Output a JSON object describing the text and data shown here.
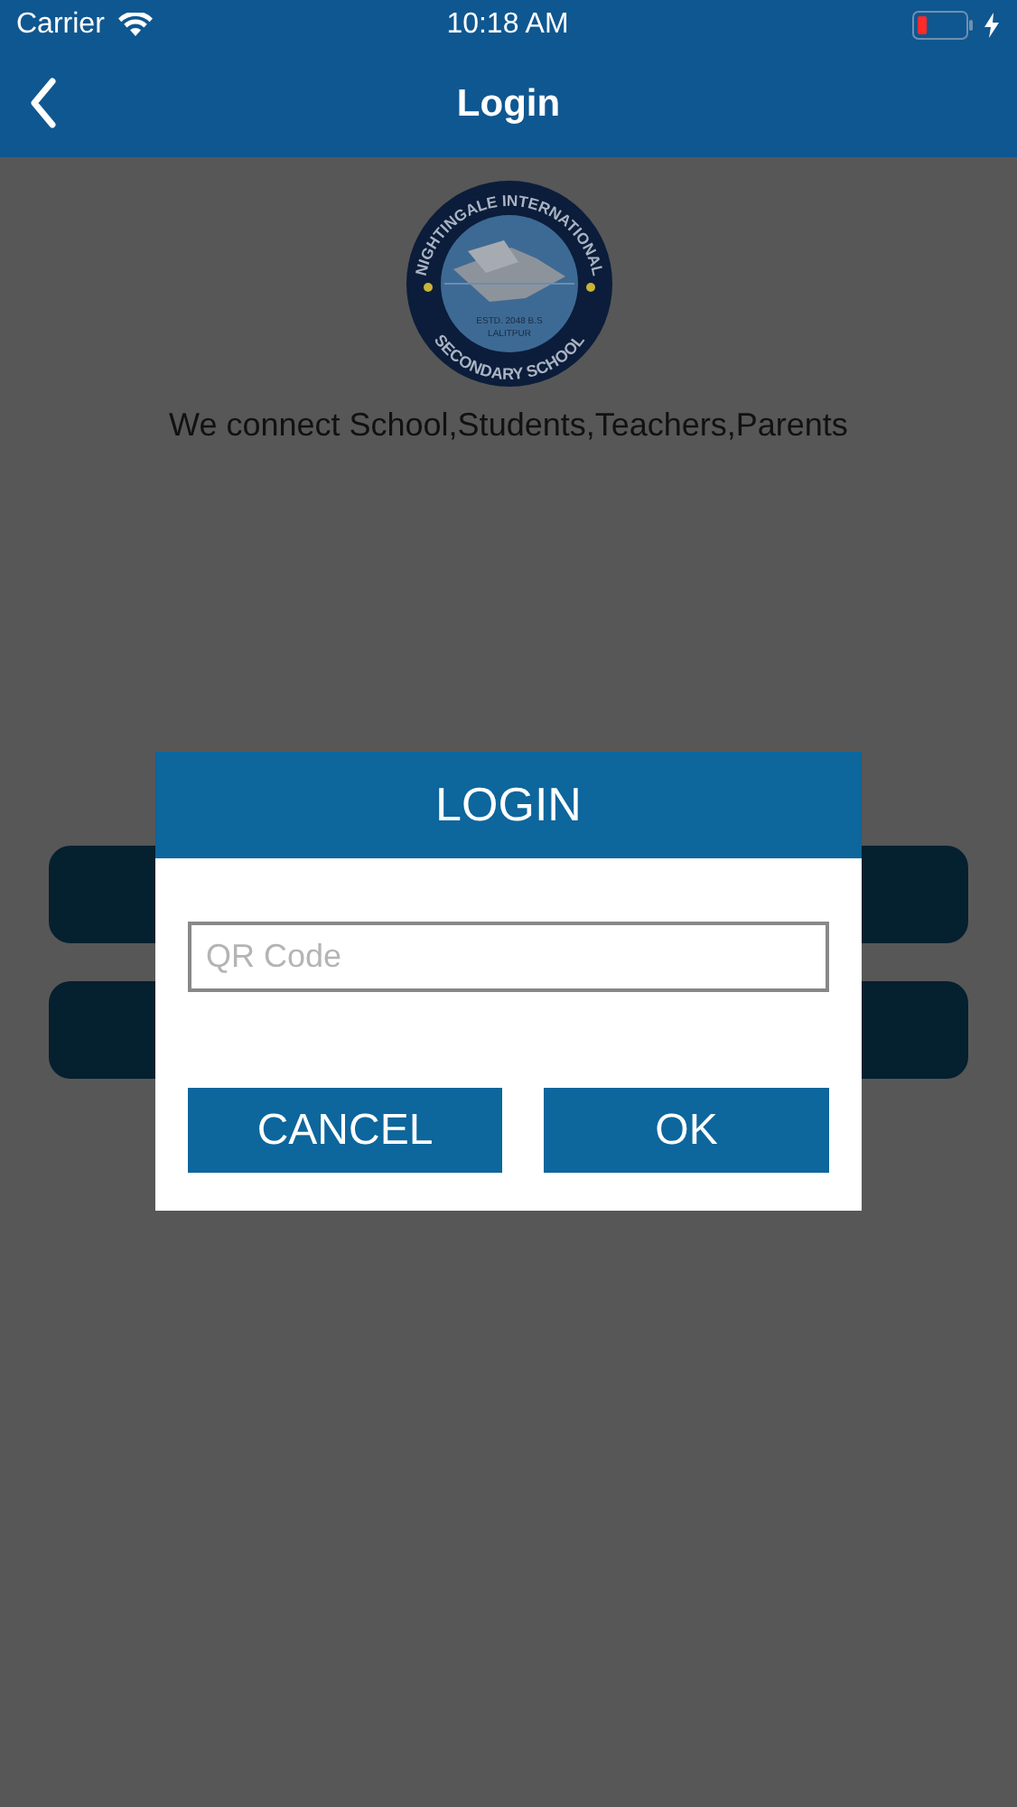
{
  "status_bar": {
    "carrier": "Carrier",
    "time": "10:18 AM",
    "charging": true
  },
  "nav_bar": {
    "title": "Login"
  },
  "logo": {
    "top_text": "NIGHTINGALE INTERNATIONAL",
    "bottom_text": "SECONDARY SCHOOL",
    "center_lines": [
      "ESTD. 2048 B.S",
      "LALITPUR"
    ]
  },
  "tagline": "We connect School,Students,Teachers,Parents",
  "background_buttons": [
    {
      "kind": "dimmed"
    },
    {
      "kind": "dimmed"
    }
  ],
  "dialog": {
    "title": "LOGIN",
    "field": {
      "placeholder": "QR Code"
    },
    "buttons": [
      "CANCEL",
      "OK"
    ]
  }
}
